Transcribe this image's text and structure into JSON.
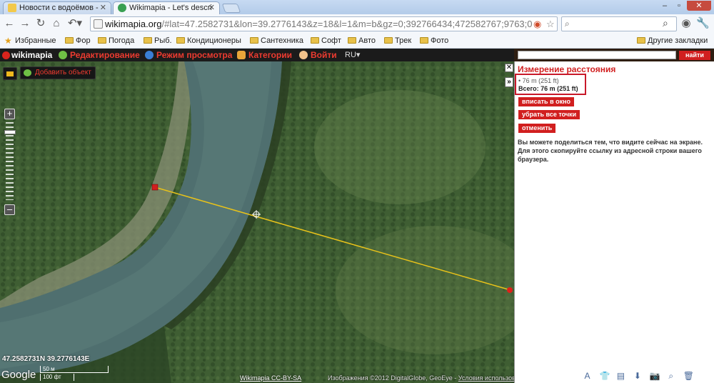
{
  "browser": {
    "tabs": [
      {
        "title": "Новости с водоёмов - "
      },
      {
        "title": "Wikimapia - Let's descri"
      }
    ],
    "url": {
      "host": "wikimapia.org",
      "path": "/#lat=47.2582731&lon=39.2776143&z=18&l=1&m=b&gz=0;392766434;472582767;9763;0"
    },
    "bookmarks": [
      {
        "label": "Избранные"
      },
      {
        "label": "Фор"
      },
      {
        "label": "Погода"
      },
      {
        "label": "Рыб."
      },
      {
        "label": "Кондиционеры"
      },
      {
        "label": "Сантехника"
      },
      {
        "label": "Софт"
      },
      {
        "label": "Авто"
      },
      {
        "label": "Трек"
      },
      {
        "label": "Фото"
      }
    ],
    "other_bookmarks": "Другие закладки"
  },
  "wikimapia": {
    "logo": "wikimapia",
    "menu": [
      {
        "label": "Редактирование"
      },
      {
        "label": "Режим просмотра"
      },
      {
        "label": "Категории"
      },
      {
        "label": "Войти"
      }
    ],
    "lang": "RU",
    "find_button": "найти",
    "add_object": "Добавить объект"
  },
  "map": {
    "coords": "47.2582731N 39.2776143E",
    "google": "Google",
    "scale_top": "50 м",
    "scale_bottom": "100 фт",
    "license": "Wikimapia CC-BY-SA",
    "imagery_prefix": "Изображения ©2012 DigitalGlobe, GeoEye - ",
    "imagery_terms": "Условия использования"
  },
  "panel": {
    "title": "Измерение расстояния",
    "segment": "• 76 m (251 ft)",
    "total": "Всего: 76 m (251 ft)",
    "buttons": [
      {
        "label": "вписать в окно"
      },
      {
        "label": "убрать все точки"
      },
      {
        "label": "отменить"
      }
    ],
    "share_text": "Вы можете поделиться тем, что видите сейчас на экране. Для этого скопируйте ссылку из адресной строки вашего браузера."
  },
  "colors": {
    "accent_red": "#d11f1f",
    "measure_line": "#e8c21a"
  }
}
